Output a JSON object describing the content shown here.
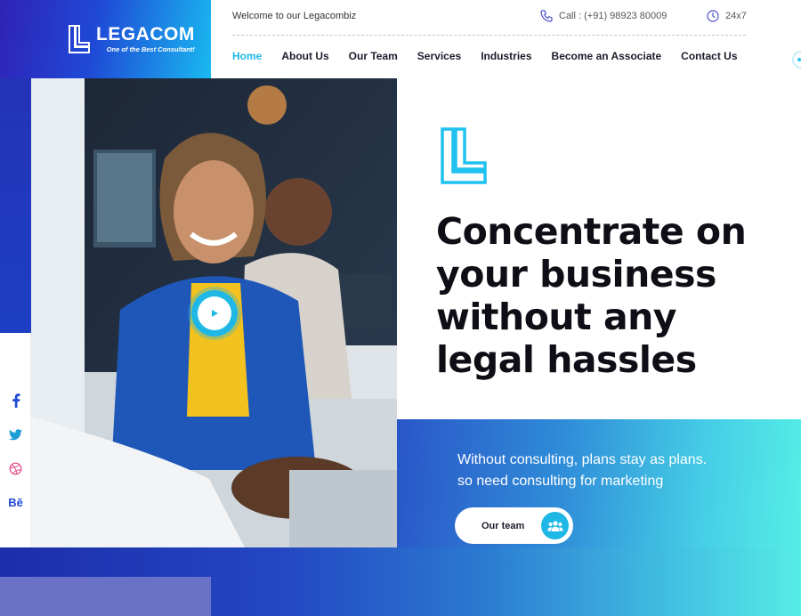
{
  "brand": {
    "name": "LEGACOM",
    "tagline": "One of the Best Consultant!"
  },
  "topbar": {
    "welcome": "Welcome to our Legacombiz",
    "call": "Call : (+91) 98923 80009",
    "hours": "24x7"
  },
  "nav": {
    "items": [
      {
        "label": "Home",
        "active": true
      },
      {
        "label": "About Us"
      },
      {
        "label": "Our Team"
      },
      {
        "label": "Services"
      },
      {
        "label": "Industries"
      },
      {
        "label": "Become an Associate"
      },
      {
        "label": "Contact Us"
      }
    ]
  },
  "hero": {
    "headline_lines": [
      "Concentrate on",
      "your business",
      "without any",
      "legal hassles"
    ],
    "sub_lines": [
      "Without consulting, plans stay as plans.",
      "so need consulting for marketing"
    ],
    "cta_label": "Our team"
  },
  "social": {
    "items": [
      "facebook-icon",
      "twitter-icon",
      "dribbble-icon",
      "behance-icon"
    ],
    "behance_text": "Bē"
  },
  "colors": {
    "accent": "#1fb8e6",
    "brand_blue": "#2f22b6",
    "heading": "#0e0e16"
  }
}
